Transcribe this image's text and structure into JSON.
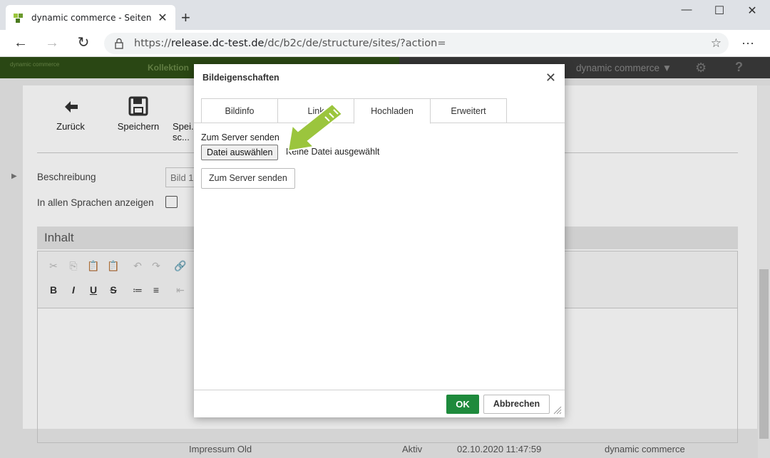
{
  "browser": {
    "tab_title": "dynamic commerce - Seiten",
    "tab_close": "✕",
    "new_tab": "+",
    "url_prefix": "https://",
    "url_domain": "release.dc-test.de",
    "url_path": "/dc/b2c/de/structure/sites/?action=",
    "star": "☆",
    "menu": "···",
    "minimize": "—",
    "maximize": "☐",
    "close": "✕"
  },
  "app": {
    "logo_text": "dynamic commerce",
    "nav_item": "Kollektion",
    "brand_menu": "dynamic commerce ▼",
    "help": "?",
    "toolbar": {
      "back_label": "Zurück",
      "save_label": "Speichern",
      "save_close_label": "Spei... sc..."
    },
    "fields": {
      "description_label": "Beschreibung",
      "description_value": "Bild 1",
      "all_languages_label": "In allen Sprachen anzeigen"
    },
    "content_section": "Inhalt",
    "editor_tools_row1": [
      "✂",
      "⎘",
      "📋",
      "📋",
      "↶",
      "↷",
      "🔗"
    ],
    "editor_tools_row2": [
      "B",
      "I",
      "U",
      "S",
      "≔",
      "≡",
      "⇤"
    ],
    "bottom_row": {
      "name": "Impressum Old",
      "status": "Aktiv",
      "date": "02.10.2020 11:47:59",
      "owner": "dynamic commerce"
    }
  },
  "dialog": {
    "title": "Bildeigenschaften",
    "close_symbol": "✕",
    "tabs": [
      {
        "label": "Bildinfo",
        "active": false
      },
      {
        "label": "Link",
        "active": false
      },
      {
        "label": "Hochladen",
        "active": true
      },
      {
        "label": "Erweitert",
        "active": false
      }
    ],
    "upload_label": "Zum Server senden",
    "file_button": "Datei auswählen",
    "file_none": "Keine Datei ausgewählt",
    "send_button": "Zum Server senden",
    "ok_button": "OK",
    "cancel_button": "Abbrechen"
  },
  "colors": {
    "accent_green": "#1e8a3c",
    "annotation_arrow": "#9bc53d"
  }
}
